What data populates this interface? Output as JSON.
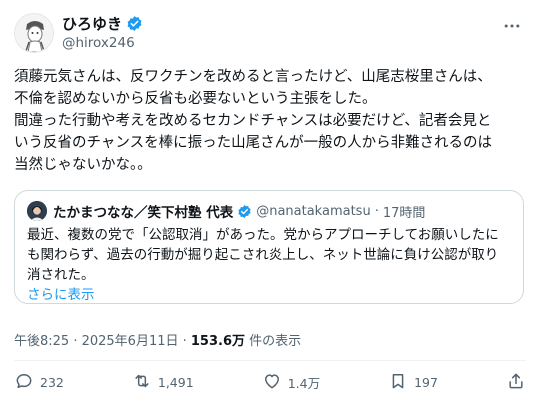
{
  "author": {
    "display_name": "ひろゆき",
    "handle": "@hirox246"
  },
  "tweet": {
    "text": "須藤元気さんは、反ワクチンを改めると言ったけど、山尾志桜里さんは、\n不倫を認めないから反省も必要ないという主張をした。\n間違った行動や考えを改めるセカンドチャンスは必要だけど、記者会見と\nいう反省のチャンスを棒に振った山尾さんが一般の人から非難されるのは\n当然じゃないかな。。"
  },
  "quote": {
    "display_name": "たかまつなな／笑下村塾 代表",
    "handle": "@nanatakamatsu",
    "separator": "·",
    "time": "17時間",
    "text": "最近、複数の党で「公認取消」があった。党からアプローチしてお願いしたにも関わらず、過去の行動が掘り起こされ炎上し、ネット世論に負け公認が取り消された。",
    "show_more": "さらに表示"
  },
  "meta": {
    "timestamp": "午後8:25 · 2025年6月11日 · ",
    "views_count": "153.6万",
    "views_label": " 件の表示"
  },
  "actions": {
    "replies": "232",
    "retweets": "1,491",
    "likes": "1.4万",
    "bookmarks": "197"
  },
  "colors": {
    "verified": "#1d9bf0",
    "link": "#1d9bf0",
    "secondary_text": "#536471"
  }
}
